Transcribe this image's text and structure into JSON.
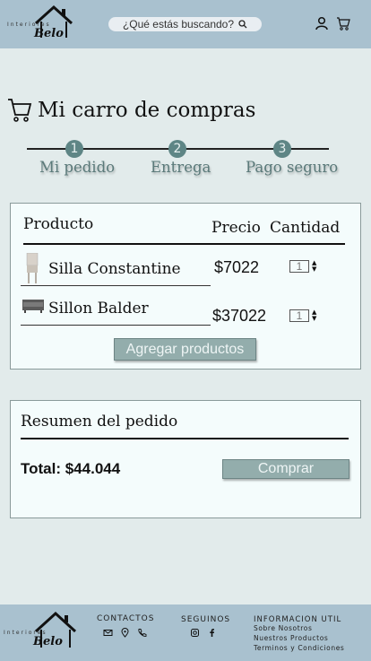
{
  "header": {
    "logo_word": "Interiores",
    "logo_brand": "Belo",
    "search_placeholder": "¿Qué estás buscando?",
    "icons": [
      "user-icon",
      "cart-icon",
      "search-icon"
    ]
  },
  "title": "Mi carro de compras",
  "steps": [
    {
      "number": "1",
      "label": "Mi pedido"
    },
    {
      "number": "2",
      "label": "Entrega"
    },
    {
      "number": "3",
      "label": "Pago seguro"
    }
  ],
  "cart": {
    "columns": {
      "product": "Producto",
      "price": "Precio",
      "quantity": "Cantidad"
    },
    "items": [
      {
        "name": "Silla Constantine",
        "price": "$7022",
        "quantity": "1"
      },
      {
        "name": "Sillon Balder",
        "price": "$37022",
        "quantity": "1"
      }
    ],
    "add_button": "Agregar productos"
  },
  "summary": {
    "title": "Resumen del pedido",
    "total": "Total: $44.044",
    "buy_button": "Comprar"
  },
  "footer": {
    "logo_word": "Interiores",
    "logo_brand": "Belo",
    "contacts_title": "CONTACTOS",
    "follow_title": "SEGUINOS",
    "info_title": "INFORMACION UTIL",
    "info_links": [
      "Sobre Nosotros",
      "Nuestros Productos",
      "Terminos y Condiciones"
    ]
  },
  "colors": {
    "header_bg": "#a9c1cf",
    "page_bg": "#e2ebeb",
    "accent": "#5e8585",
    "button_bg": "#93adac",
    "panel_bg": "#f4fcfc"
  }
}
